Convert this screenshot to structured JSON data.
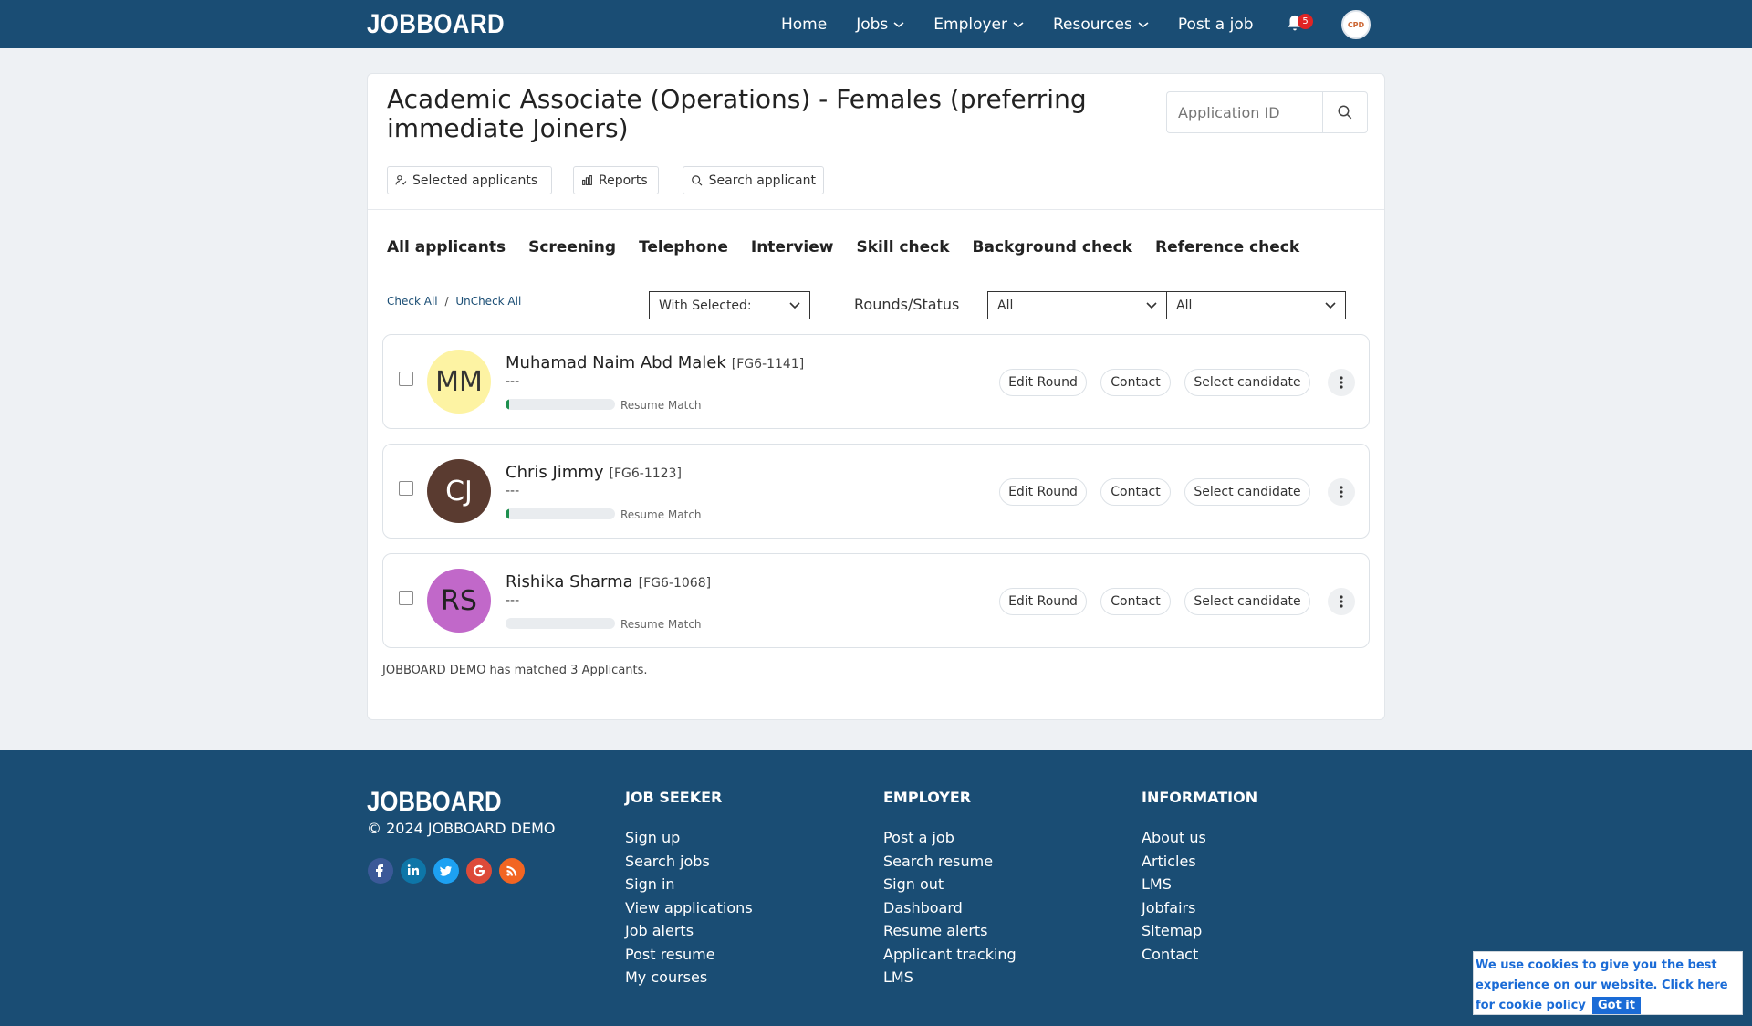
{
  "header": {
    "logo": "JOBBOARD",
    "nav": [
      {
        "label": "Home",
        "has_dropdown": false
      },
      {
        "label": "Jobs",
        "has_dropdown": true
      },
      {
        "label": "Employer",
        "has_dropdown": true
      },
      {
        "label": "Resources",
        "has_dropdown": true
      },
      {
        "label": "Post a job",
        "has_dropdown": false
      }
    ],
    "notification_count": "5",
    "avatar_text": "CPD"
  },
  "job": {
    "title": "Academic Associate (Operations) - Females (preferring immediate Joiners)",
    "application_id_placeholder": "Application ID"
  },
  "toolbar": {
    "selected_applicants": "Selected applicants",
    "reports": "Reports",
    "search_applicant": "Search applicant"
  },
  "tabs": [
    "All applicants",
    "Screening",
    "Telephone",
    "Interview",
    "Skill check",
    "Background check",
    "Reference check"
  ],
  "filters": {
    "check_all": "Check All",
    "separator": "/",
    "uncheck_all": "UnCheck All",
    "with_selected": "With Selected:",
    "rounds_label": "Rounds/Status",
    "round_value": "All",
    "status_value": "All"
  },
  "applicant_actions": {
    "edit_round": "Edit Round",
    "contact": "Contact",
    "select_candidate": "Select candidate",
    "match_label": "Resume Match"
  },
  "applicants": [
    {
      "initials": "MM",
      "name": "Muhamad Naim Abd Malek",
      "id": "[FG6-1141]",
      "subtitle": "---",
      "avatar_bg": "#fdf3a3",
      "avatar_fg": "#333333",
      "match_fraction": 0.03
    },
    {
      "initials": "CJ",
      "name": "Chris Jimmy",
      "id": "[FG6-1123]",
      "subtitle": "---",
      "avatar_bg": "#5a3b30",
      "avatar_fg": "#ffffff",
      "match_fraction": 0.03
    },
    {
      "initials": "RS",
      "name": "Rishika Sharma",
      "id": "[FG6-1068]",
      "subtitle": "---",
      "avatar_bg": "#c168c9",
      "avatar_fg": "#222222",
      "match_fraction": 0
    }
  ],
  "matched_note": "JOBBOARD DEMO has matched 3 Applicants.",
  "footer": {
    "logo": "JOBBOARD",
    "copyright": "© 2024 JOBBOARD DEMO",
    "socials": [
      {
        "name": "facebook-icon",
        "color": "#3b5998"
      },
      {
        "name": "linkedin-icon",
        "color": "#0e76a8"
      },
      {
        "name": "twitter-icon",
        "color": "#1da1f2"
      },
      {
        "name": "google-icon",
        "color": "#dd4b39"
      },
      {
        "name": "rss-icon",
        "color": "#f26522"
      }
    ],
    "columns": [
      {
        "heading": "JOB SEEKER",
        "links": [
          "Sign up",
          "Search jobs",
          "Sign in",
          "View applications",
          "Job alerts",
          "Post resume",
          "My courses"
        ]
      },
      {
        "heading": "EMPLOYER",
        "links": [
          "Post a job",
          "Search resume",
          "Sign out",
          "Dashboard",
          "Resume alerts",
          "Applicant tracking",
          "LMS"
        ]
      },
      {
        "heading": "INFORMATION",
        "links": [
          "About us",
          "Articles",
          "LMS",
          "Jobfairs",
          "Sitemap",
          "Contact"
        ]
      }
    ]
  },
  "cookie": {
    "text": "We use cookies to give you the best experience on our website. Click here for cookie policy",
    "button": "Got it"
  },
  "colors": {
    "brand": "#1a4d74",
    "badge": "#e02424",
    "match": "#1e8f4e",
    "cookie_accent": "#1a6bd6"
  }
}
